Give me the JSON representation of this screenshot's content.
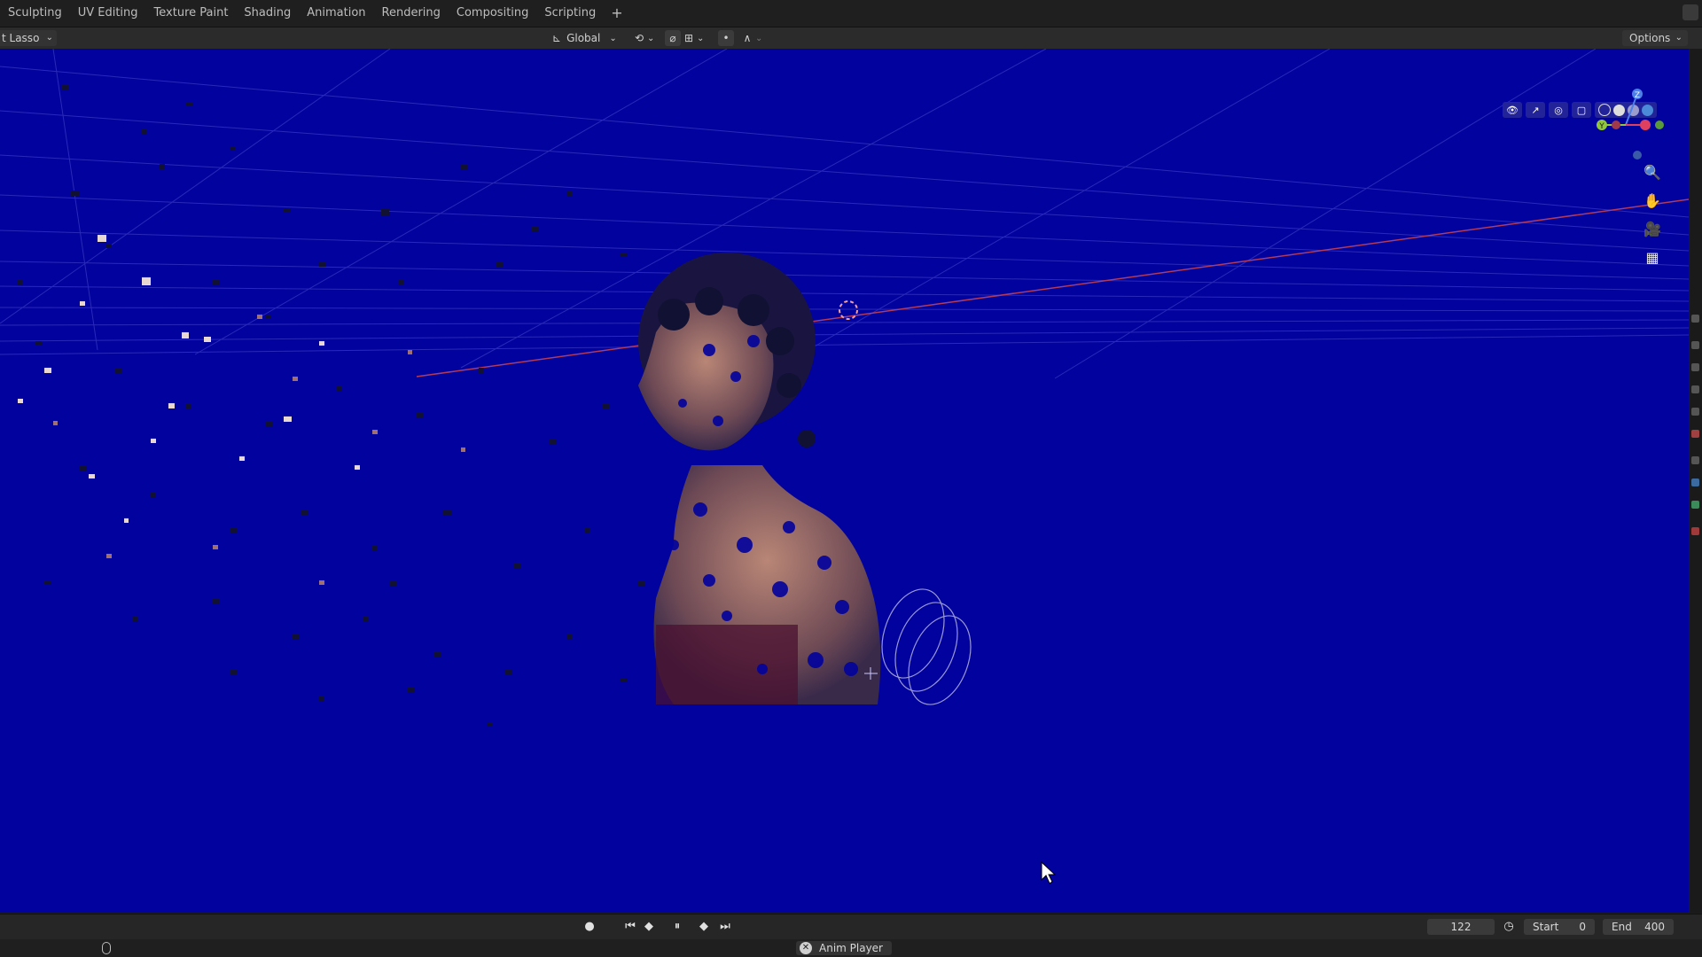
{
  "workspace_tabs": [
    "Sculpting",
    "UV Editing",
    "Texture Paint",
    "Shading",
    "Animation",
    "Rendering",
    "Compositing",
    "Scripting"
  ],
  "add_workspace_label": "+",
  "header": {
    "select_tool": "t Lasso",
    "transform_orientation": "Global",
    "options_label": "Options"
  },
  "viewport": {
    "background_color": "#02029e",
    "gizmo_axes": {
      "x": "X",
      "y": "Y",
      "z": "Z"
    }
  },
  "timeline": {
    "current_frame": "122",
    "start_label": "Start",
    "start_value": "0",
    "end_label": "End",
    "end_value": "400"
  },
  "statusbar": {
    "anim_player_label": "Anim Player"
  },
  "icons": [
    "mouse-icon",
    "record-icon",
    "jump-start-icon",
    "prev-keyframe-icon",
    "pause-icon",
    "next-keyframe-icon",
    "jump-end-icon",
    "stopwatch-icon",
    "zoom-icon",
    "hand-pan-icon",
    "camera-icon",
    "ortho-grid-icon",
    "close-icon"
  ]
}
